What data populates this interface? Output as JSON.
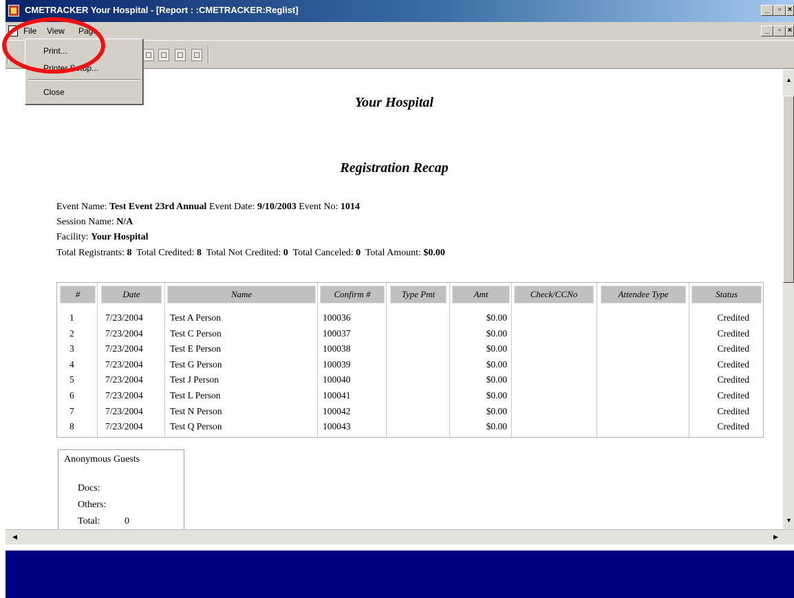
{
  "window": {
    "title": "CMETRACKER  Your Hospital - [Report : :CMETRACKER:Reglist]",
    "minimize": "_",
    "maximize": "▫",
    "close": "×"
  },
  "menu": {
    "file": "File",
    "view": "View",
    "page": "Page"
  },
  "file_menu": {
    "print": "Print...",
    "printer_setup": "Printer Setup...",
    "close": "Close"
  },
  "report": {
    "hospital": "Your Hospital",
    "title": "Registration Recap",
    "labels": {
      "event_name": "Event Name:",
      "event_date": "Event Date:",
      "event_no": "Event No:",
      "session_name": "Session Name:",
      "facility": "Facility:",
      "total_registrants": "Total Registrants:",
      "total_credited": "Total Credited:",
      "total_not_credited": "Total Not Credited:",
      "total_canceled": "Total Canceled:",
      "total_amount": "Total Amount:"
    },
    "values": {
      "event_name": "Test Event 23rd Annual",
      "event_date": "9/10/2003",
      "event_no": "1014",
      "session_name": "N/A",
      "facility": "Your Hospital",
      "total_registrants": "8",
      "total_credited": "8",
      "total_not_credited": "0",
      "total_canceled": "0",
      "total_amount": "$0.00"
    }
  },
  "table": {
    "headers": [
      "#",
      "Date",
      "Name",
      "Confirm #",
      "Type Pmt",
      "Amt",
      "Check/CCNo",
      "Attendee Type",
      "Status"
    ],
    "rows": [
      [
        "1",
        "7/23/2004",
        "Test A Person",
        "100036",
        "",
        "$0.00",
        "",
        "",
        "Credited"
      ],
      [
        "2",
        "7/23/2004",
        "Test C Person",
        "100037",
        "",
        "$0.00",
        "",
        "",
        "Credited"
      ],
      [
        "3",
        "7/23/2004",
        "Test E Person",
        "100038",
        "",
        "$0.00",
        "",
        "",
        "Credited"
      ],
      [
        "4",
        "7/23/2004",
        "Test G Person",
        "100039",
        "",
        "$0.00",
        "",
        "",
        "Credited"
      ],
      [
        "5",
        "7/23/2004",
        "Test J Person",
        "100040",
        "",
        "$0.00",
        "",
        "",
        "Credited"
      ],
      [
        "6",
        "7/23/2004",
        "Test L Person",
        "100041",
        "",
        "$0.00",
        "",
        "",
        "Credited"
      ],
      [
        "7",
        "7/23/2004",
        "Test N Person",
        "100042",
        "",
        "$0.00",
        "",
        "",
        "Credited"
      ],
      [
        "8",
        "7/23/2004",
        "Test Q Person",
        "100043",
        "",
        "$0.00",
        "",
        "",
        "Credited"
      ]
    ]
  },
  "guests": {
    "title": "Anonymous Guests",
    "docs": "Docs:",
    "others": "Others:",
    "total": "Total:",
    "total_value": "0"
  }
}
